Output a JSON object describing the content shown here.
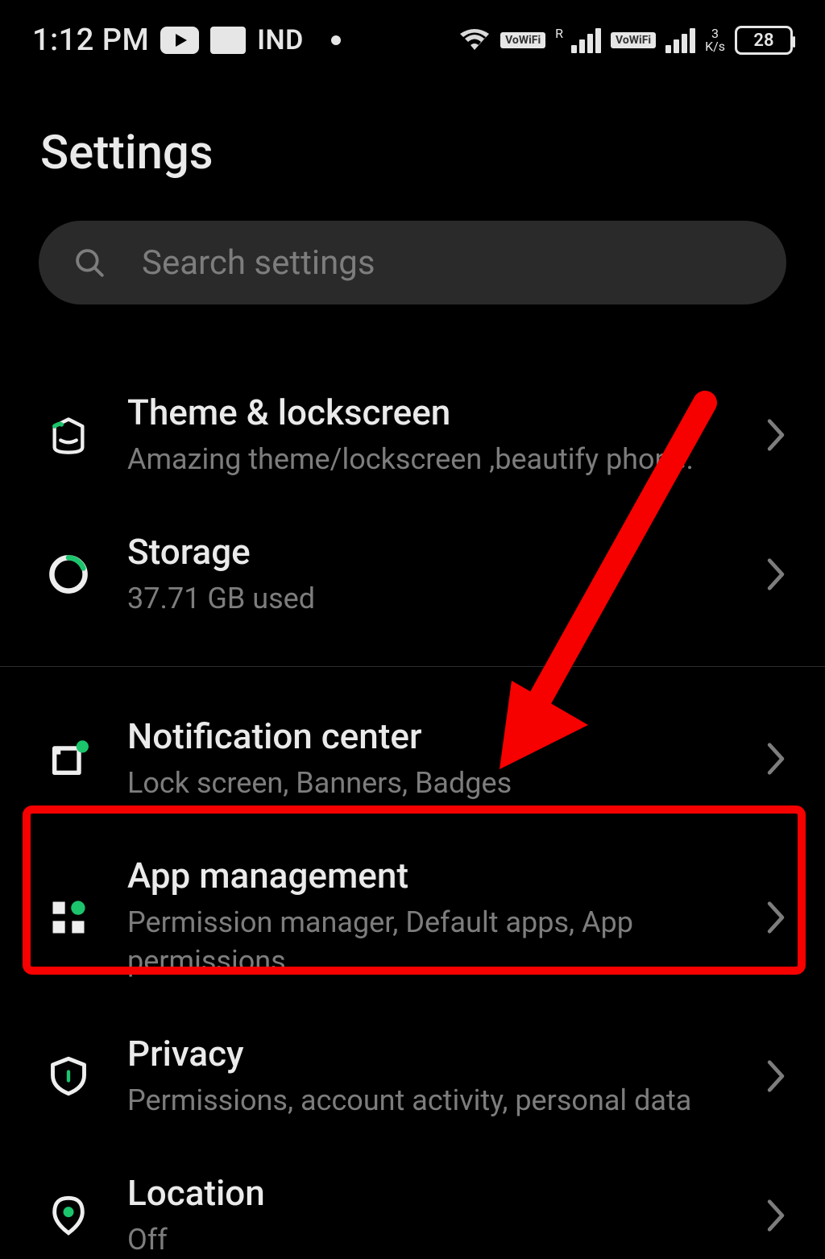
{
  "status": {
    "time": "1:12 PM",
    "carrier": "IND",
    "vowifi1": "VoWiFi",
    "vowifi2": "VoWiFi",
    "roaming": "R",
    "speed_value": "3",
    "speed_unit": "K/s",
    "battery": "28"
  },
  "page_title": "Settings",
  "search": {
    "placeholder": "Search settings"
  },
  "items": [
    {
      "title": "Theme & lockscreen",
      "sub": "Amazing theme/lockscreen ,beautify phone."
    },
    {
      "title": "Storage",
      "sub": "37.71 GB used"
    },
    {
      "title": "Notification center",
      "sub": "Lock screen, Banners, Badges"
    },
    {
      "title": "App management",
      "sub": "Permission manager, Default apps, App permissions"
    },
    {
      "title": "Privacy",
      "sub": "Permissions, account activity, personal data"
    },
    {
      "title": "Location",
      "sub": "Off"
    }
  ]
}
